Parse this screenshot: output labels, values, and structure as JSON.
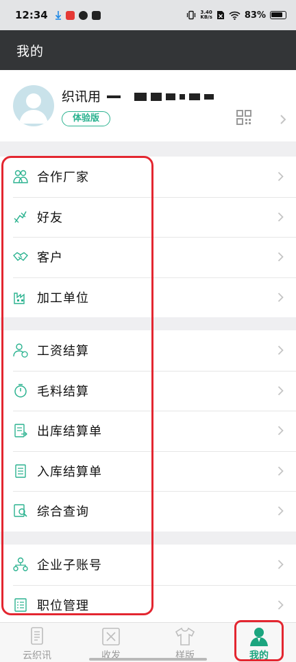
{
  "status_bar": {
    "time": "12:34",
    "net_speed_value": "3.40",
    "net_speed_unit": "KB/s",
    "battery": "83%"
  },
  "header": {
    "title": "我的"
  },
  "profile": {
    "name": "织讯用",
    "plan_badge": "体验版"
  },
  "sections": [
    {
      "items": [
        {
          "label": "合作厂家",
          "icon": "partners-icon"
        },
        {
          "label": "好友",
          "icon": "friends-icon"
        },
        {
          "label": "客户",
          "icon": "handshake-icon"
        },
        {
          "label": "加工单位",
          "icon": "factory-icon"
        }
      ]
    },
    {
      "items": [
        {
          "label": "工资结算",
          "icon": "salary-icon"
        },
        {
          "label": "毛料结算",
          "icon": "timer-icon"
        },
        {
          "label": "出库结算单",
          "icon": "outbound-icon"
        },
        {
          "label": "入库结算单",
          "icon": "inbound-icon"
        },
        {
          "label": "综合查询",
          "icon": "query-icon"
        }
      ]
    },
    {
      "items": [
        {
          "label": "企业子账号",
          "icon": "sub-account-icon"
        },
        {
          "label": "职位管理",
          "icon": "position-icon"
        }
      ]
    }
  ],
  "bottom_nav": {
    "tabs": [
      {
        "label": "云织讯",
        "icon": "document-icon",
        "active": false
      },
      {
        "label": "收发",
        "icon": "send-receive-icon",
        "active": false
      },
      {
        "label": "样版",
        "icon": "shirt-icon",
        "active": false
      },
      {
        "label": "我的",
        "icon": "user-icon",
        "active": true
      }
    ]
  },
  "colors": {
    "accent": "#2ab28f",
    "header_bg": "#333537",
    "highlight": "#e32630"
  }
}
